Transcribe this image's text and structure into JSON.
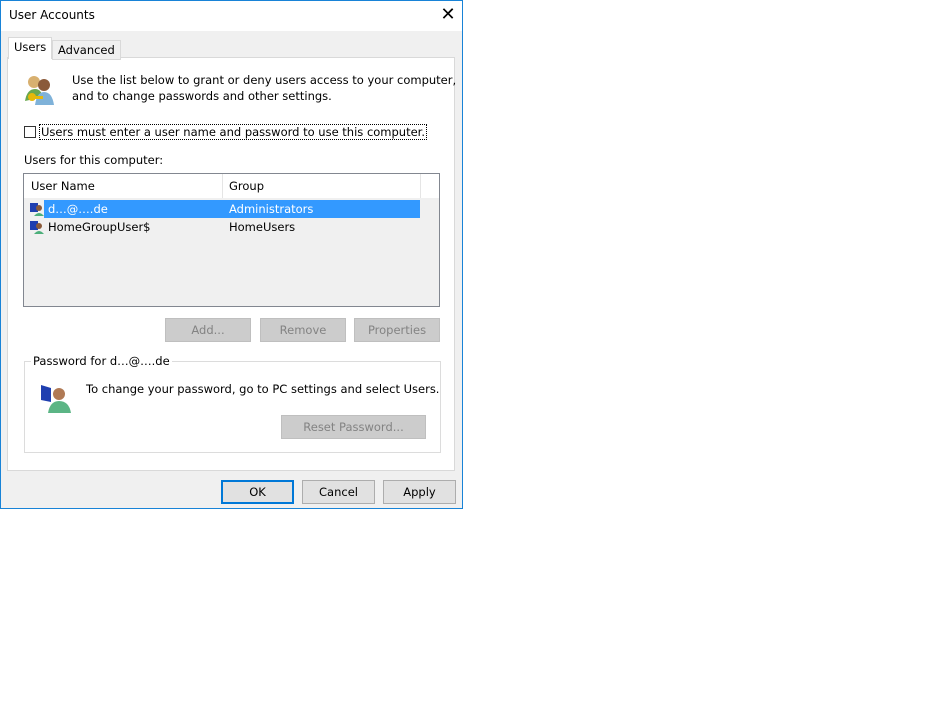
{
  "window": {
    "title": "User Accounts"
  },
  "tabs": [
    {
      "label": "Users",
      "active": true
    },
    {
      "label": "Advanced",
      "active": false
    }
  ],
  "intro": {
    "line1": "Use the list below to grant or deny users access to your computer,",
    "line2": "and to change passwords and other settings."
  },
  "checkbox": {
    "label": "Users must enter a user name and password to use this computer.",
    "checked": false
  },
  "users_label": "Users for this computer:",
  "table": {
    "columns": [
      "User Name",
      "Group"
    ],
    "rows": [
      {
        "name": "d…@….de",
        "group": "Administrators",
        "selected": true
      },
      {
        "name": "HomeGroupUser$",
        "group": "HomeUsers",
        "selected": false
      }
    ]
  },
  "buttons": {
    "add": "Add...",
    "remove": "Remove",
    "properties": "Properties",
    "reset": "Reset Password...",
    "ok": "OK",
    "cancel": "Cancel",
    "apply": "Apply"
  },
  "password_group": {
    "title": "Password for d…@….de",
    "text": "To change your password, go to PC settings and select Users."
  },
  "colors": {
    "selection": "#3399ff",
    "border": "#1883d7"
  }
}
